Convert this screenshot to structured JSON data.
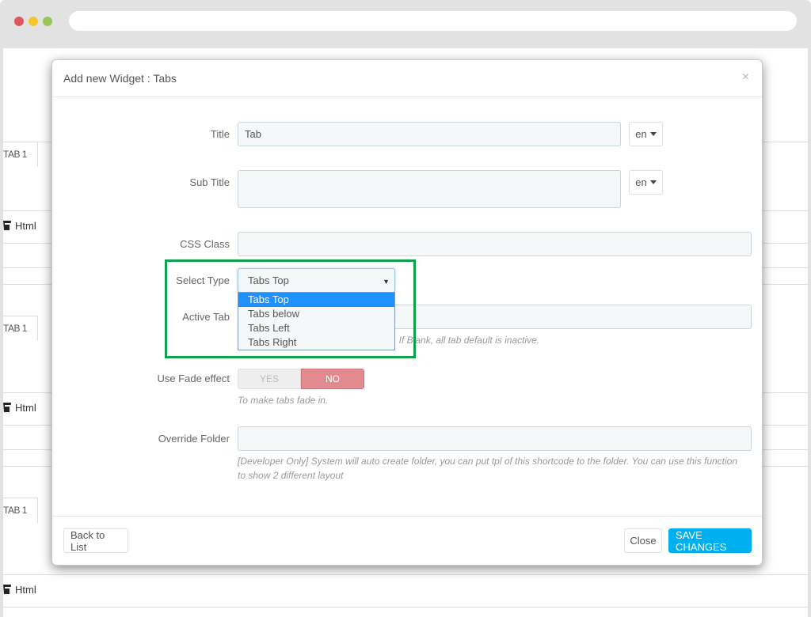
{
  "browser": {
    "dots": [
      {
        "name": "close",
        "color": "#e0575b"
      },
      {
        "name": "minimize",
        "color": "#f6c431"
      },
      {
        "name": "maximize",
        "color": "#94c755"
      }
    ]
  },
  "background_page": {
    "tab_label": "TAB 1",
    "html_label": "Html"
  },
  "modal": {
    "title": "Add new Widget : Tabs",
    "close_glyph": "×",
    "fields": {
      "title": {
        "label": "Title",
        "value": "Tab",
        "lang": "en"
      },
      "sub_title": {
        "label": "Sub Title",
        "value": "",
        "lang": "en"
      },
      "css_class": {
        "label": "CSS Class",
        "value": ""
      },
      "select_type": {
        "label": "Select Type",
        "value": "Tabs Top",
        "arrow": "▼",
        "options": [
          "Tabs Top",
          "Tabs below",
          "Tabs Left",
          "Tabs Right"
        ],
        "highlighted_option": "Tabs Top"
      },
      "active_tab": {
        "label": "Active Tab",
        "value": "",
        "help_visible": ". If Blank, all tab default is inactive."
      },
      "fade_effect": {
        "label": "Use Fade effect",
        "yes_label": "YES",
        "no_label": "NO",
        "selected": "NO",
        "help": "To make tabs fade in."
      },
      "override_folder": {
        "label": "Override Folder",
        "value": "",
        "help": "[Developer Only] System will auto create folder, you can put tpl of this shortcode to the folder. You can use this function to show 2 different layout"
      }
    },
    "footer": {
      "back_label": "Back to List",
      "close_label": "Close",
      "save_label": "SAVE CHANGES"
    }
  },
  "colors": {
    "primary": "#00aff0",
    "toggle_no": "#e38a90",
    "highlight": "#0ea04b",
    "dropdown_selected": "#1e90ff"
  }
}
